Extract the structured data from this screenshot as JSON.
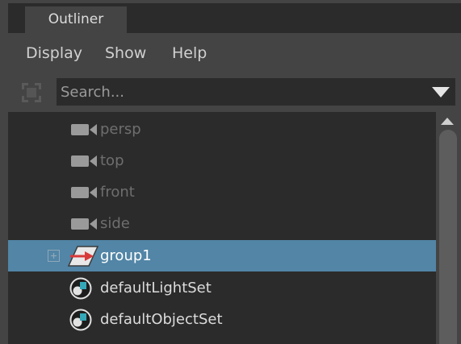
{
  "panel": {
    "tab_label": "Outliner"
  },
  "menu": {
    "items": [
      "Display",
      "Show",
      "Help"
    ]
  },
  "search": {
    "placeholder": "Search..."
  },
  "tree": {
    "items": [
      {
        "label": "persp",
        "icon": "camera-icon",
        "state": "dim"
      },
      {
        "label": "top",
        "icon": "camera-icon",
        "state": "dim"
      },
      {
        "label": "front",
        "icon": "camera-icon",
        "state": "dim"
      },
      {
        "label": "side",
        "icon": "camera-icon",
        "state": "dim"
      },
      {
        "label": "group1",
        "icon": "group-transform-icon",
        "state": "selected",
        "expandable": true
      },
      {
        "label": "defaultLightSet",
        "icon": "set-icon",
        "state": "active"
      },
      {
        "label": "defaultObjectSet",
        "icon": "set-icon",
        "state": "active"
      }
    ]
  },
  "colors": {
    "panel_bg": "#444444",
    "tree_bg": "#2b2b2b",
    "selection": "#5285a6",
    "dim_text": "#6e6e6e",
    "active_text": "#dcdcdc",
    "group_icon_red": "#d83a3a"
  }
}
